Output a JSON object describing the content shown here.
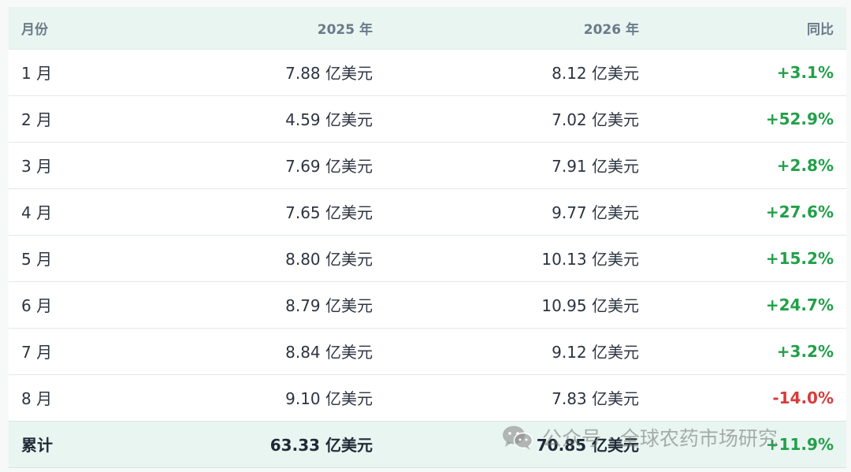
{
  "table": {
    "headers": {
      "month": "月份",
      "y2025": "2025 年",
      "y2026": "2026 年",
      "yoy": "同比"
    },
    "rows": [
      {
        "month": "1 月",
        "y2025": "7.88 亿美元",
        "y2026": "8.12 亿美元",
        "yoy": "+3.1%"
      },
      {
        "month": "2 月",
        "y2025": "4.59 亿美元",
        "y2026": "7.02 亿美元",
        "yoy": "+52.9%"
      },
      {
        "month": "3 月",
        "y2025": "7.69 亿美元",
        "y2026": "7.91 亿美元",
        "yoy": "+2.8%"
      },
      {
        "month": "4 月",
        "y2025": "7.65 亿美元",
        "y2026": "9.77 亿美元",
        "yoy": "+27.6%"
      },
      {
        "month": "5 月",
        "y2025": "8.80 亿美元",
        "y2026": "10.13 亿美元",
        "yoy": "+15.2%"
      },
      {
        "month": "6 月",
        "y2025": "8.79 亿美元",
        "y2026": "10.95 亿美元",
        "yoy": "+24.7%"
      },
      {
        "month": "7 月",
        "y2025": "8.84 亿美元",
        "y2026": "9.12 亿美元",
        "yoy": "+3.2%"
      },
      {
        "month": "8 月",
        "y2025": "9.10 亿美元",
        "y2026": "7.83 亿美元",
        "yoy": "-14.0%"
      }
    ],
    "total": {
      "month": "累计",
      "y2025": "63.33 亿美元",
      "y2026": "70.85 亿美元",
      "yoy": "+11.9%"
    }
  },
  "watermark": {
    "text": "公众号 · 全球农药市场研究",
    "icon": "wechat-icon"
  },
  "colors": {
    "header_bg": "#e8f5f1",
    "positive": "#22a049",
    "negative": "#d93a3a"
  }
}
